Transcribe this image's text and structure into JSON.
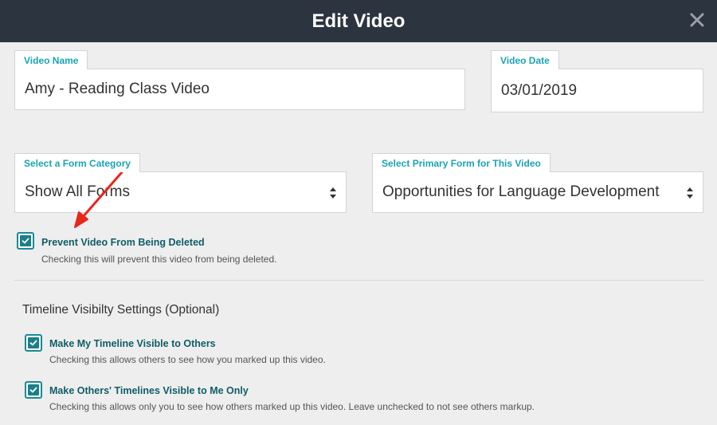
{
  "dialog": {
    "title": "Edit Video"
  },
  "form": {
    "video_name": {
      "label": "Video Name",
      "value": "Amy - Reading Class Video"
    },
    "video_date": {
      "label": "Video Date",
      "value": "03/01/2019"
    },
    "form_category": {
      "label": "Select a Form Category",
      "value": "Show All Forms"
    },
    "primary_form": {
      "label": "Select Primary Form for This Video",
      "value": "Opportunities for Language Development"
    },
    "prevent_delete": {
      "label": "Prevent Video From Being Deleted",
      "help": "Checking this will prevent this video from being deleted.",
      "checked": true
    }
  },
  "timeline": {
    "section_title": "Timeline Visibilty Settings (Optional)",
    "visible_to_others": {
      "label": "Make My Timeline Visible to Others",
      "help": "Checking this allows others to see how you marked up this video.",
      "checked": true
    },
    "others_visible_to_me": {
      "label": "Make Others' Timelines Visible to Me Only",
      "help": "Checking this allows only you to see how others marked up this video. Leave unchecked to not see others markup.",
      "checked": true
    }
  },
  "colors": {
    "header_bg": "#2c3440",
    "accent": "#1aa3b5",
    "checkbox": "#1a7f8b",
    "annotation_arrow": "#e8261c"
  },
  "icons": {
    "close": "close-icon",
    "select_arrows": "select-arrows-icon",
    "check": "check-icon",
    "annotation": "red-arrow-annotation"
  }
}
